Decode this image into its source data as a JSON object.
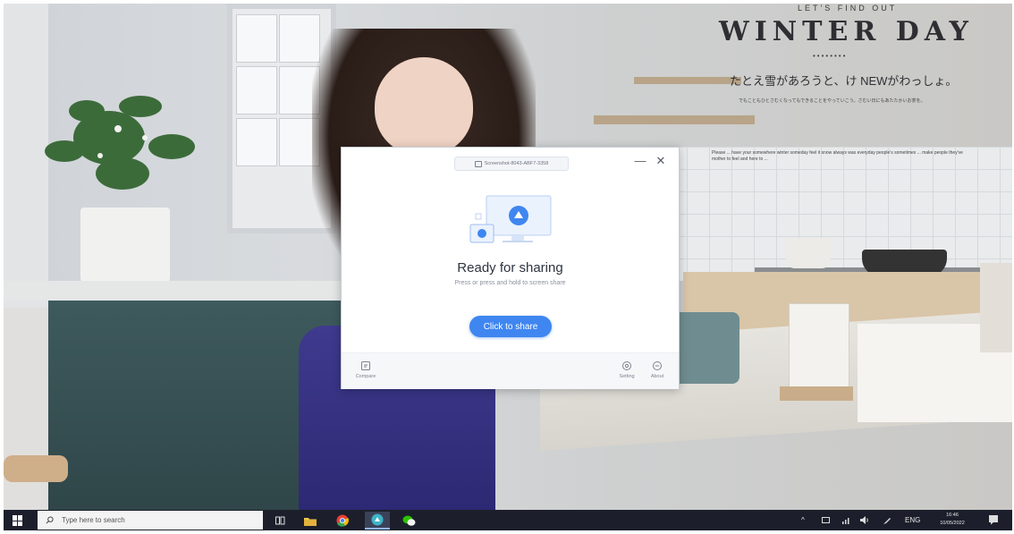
{
  "wallpaper": {
    "lets_find_out": "LET'S FIND OUT",
    "headline": "WINTER DAY",
    "dots": "••••••••",
    "japanese_heading": "たとえ雪があろうと、け NEWがわっしょ。",
    "japanese_body": "でもこともひとさむくなってもできることをやっていこう。さむい日にもあたたかいお茶を。",
    "english_body": "Please ... have your somewhere winter someday feel it snow always was everyday people's sometimes ... make people they've mother to feel and here to ..."
  },
  "dialog": {
    "title": "Screenshot-8043-ABF7-3358",
    "minimize": "—",
    "close": "✕",
    "heading": "Ready for sharing",
    "hint": "Press or press and hold to screen share",
    "share_button": "Click to share",
    "bottom": {
      "compare": "Compare",
      "setting": "Setting",
      "about": "About"
    },
    "colors": {
      "accent": "#3f86f0"
    }
  },
  "taskbar": {
    "search_placeholder": "Type here to search",
    "tray_lang": "ENG",
    "time": "16:46",
    "date": "10/05/2022",
    "apps": [
      "task-view-icon",
      "file-explorer-icon",
      "chrome-icon",
      "screen-share-app-icon",
      "wechat-icon"
    ]
  }
}
